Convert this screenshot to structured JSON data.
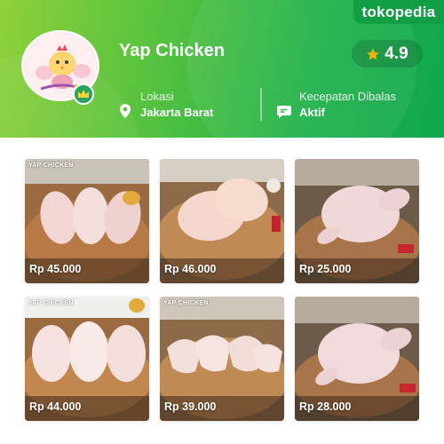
{
  "brand": {
    "name": "tokopedia",
    "color": "#119e45"
  },
  "shop": {
    "name": "Yap Chicken",
    "rating": "4.9",
    "location_label": "Lokasi",
    "location_value": "Jakarta Barat",
    "response_label": "Kecepatan Dibalas",
    "response_value": "Aktif"
  },
  "icons": {
    "star": "star-icon",
    "location": "location-pin-icon",
    "chat": "chat-bubble-icon",
    "verified": "crown-badge-icon"
  },
  "colors": {
    "header_gradient_start": "#8fd03a",
    "header_gradient_end": "#10a74c",
    "star": "#f5b400"
  },
  "products": [
    {
      "price": "Rp 45.000",
      "tag": "YAP CHICKEN",
      "kind": "thighs"
    },
    {
      "price": "Rp 46.000",
      "tag": "",
      "kind": "breast"
    },
    {
      "price": "Rp 25.000",
      "tag": "",
      "kind": "whole"
    },
    {
      "price": "Rp 44.000",
      "tag": "YAP CHICKEN",
      "kind": "thighs"
    },
    {
      "price": "Rp 39.000",
      "tag": "YAP CHICKEN",
      "kind": "wings"
    },
    {
      "price": "Rp 28.000",
      "tag": "",
      "kind": "whole"
    }
  ]
}
